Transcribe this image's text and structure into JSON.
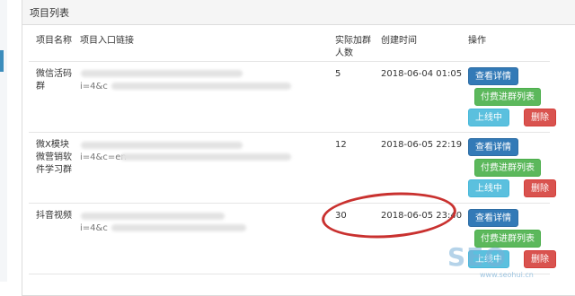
{
  "panel": {
    "title": "项目列表"
  },
  "columns": [
    "项目名称",
    "项目入口链接",
    "实际加群",
    "人数",
    "创建时间",
    "操作"
  ],
  "rows": [
    {
      "name_lines": [
        "微信活码",
        "群"
      ],
      "link_tail": "i=4&c",
      "count": "5",
      "created": "2018-06-04 01:05"
    },
    {
      "name_lines": [
        "微X模块",
        "微营销软",
        "件学习群"
      ],
      "link_tail": "i=4&c=en",
      "count": "12",
      "created": "2018-06-05 22:19"
    },
    {
      "name_lines": [
        "抖音视频"
      ],
      "link_tail": "i=4&c",
      "count": "30",
      "created": "2018-06-05 23:40"
    }
  ],
  "actions": {
    "view": "查看详情",
    "paid_list": "付费进群列表",
    "online": "上线中",
    "delete": "删除"
  },
  "watermark": {
    "text": "SEO",
    "sub": "www.seohui.cn"
  },
  "colors": {
    "primary": "#337ab7",
    "success": "#5cb85c",
    "info": "#5bc0de",
    "danger": "#d9534f",
    "annotation": "#c9312f"
  }
}
